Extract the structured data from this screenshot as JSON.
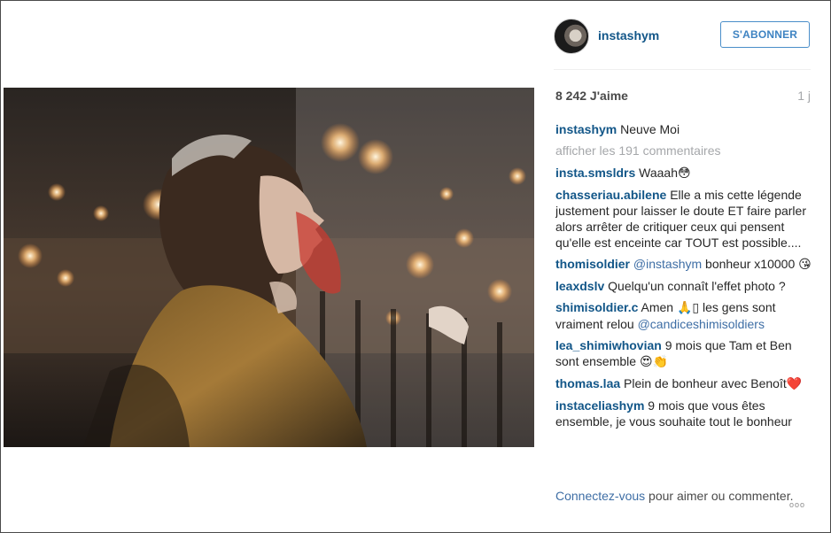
{
  "header": {
    "username": "instashym",
    "follow_label": "S'ABONNER"
  },
  "post": {
    "likes": "8 242 J'aime",
    "time": "1 j",
    "caption_user": "instashym",
    "caption_text": "Neuve Moi",
    "view_all": "afficher les 191 commentaires"
  },
  "comments": [
    {
      "user": "insta.smsldrs",
      "text": "Waaah",
      "emoji": "😳"
    },
    {
      "user": "chasseriau.abilene",
      "text": "Elle a mis cette légende justement pour laisser le doute ET faire parler alors arrêter de critiquer ceux qui pensent qu'elle est enceinte car TOUT est possible...."
    },
    {
      "user": "thomisoldier",
      "mention": "@instashym",
      "text": " bonheur x10000 ",
      "emoji": "😘"
    },
    {
      "user": "leaxdslv",
      "text": "Quelqu'un connaît l'effet photo ?"
    },
    {
      "user": "shimisoldier.c",
      "text_before": "Amen ",
      "emoji": "🙏▯",
      "text": " les gens sont vraiment relou ",
      "mention": "@candiceshimisoldiers"
    },
    {
      "user": "lea_shimiwhovian",
      "text": "9 mois que Tam et Ben sont ensemble ",
      "emoji": "😍👏"
    },
    {
      "user": "thomas.laa",
      "text": "Plein de bonheur avec Benoît",
      "emoji": "❤️"
    },
    {
      "user": "instaceliashym",
      "text": "9 mois que vous êtes ensemble, je vous souhaite tout le bonheur"
    }
  ],
  "footer": {
    "login": "Connectez-vous",
    "rest": " pour aimer ou commenter.",
    "more_icon": "ooo"
  },
  "colors": {
    "link": "#125688",
    "muted": "#a5a7aa",
    "button_blue": "#3e83c2"
  }
}
